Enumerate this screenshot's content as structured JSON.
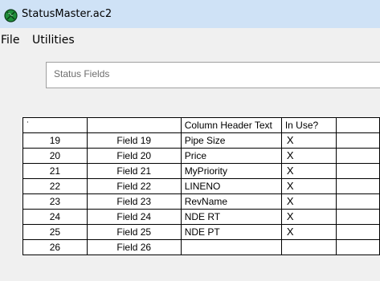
{
  "window": {
    "title": "StatusMaster.ac2"
  },
  "menu": {
    "items": [
      "File",
      "Utilities"
    ]
  },
  "status_box": {
    "label": "Status Fields"
  },
  "grid": {
    "header": {
      "corner": "˙",
      "field": "",
      "column_header_text": "Column Header Text",
      "in_use": "In Use?"
    },
    "rows": [
      {
        "num": "19",
        "field": "Field 19",
        "header_text": "Pipe Size",
        "in_use": "X"
      },
      {
        "num": "20",
        "field": "Field 20",
        "header_text": "Price",
        "in_use": "X"
      },
      {
        "num": "21",
        "field": "Field 21",
        "header_text": "MyPriority",
        "in_use": "X"
      },
      {
        "num": "22",
        "field": "Field 22",
        "header_text": "LINENO",
        "in_use": "X"
      },
      {
        "num": "23",
        "field": "Field 23",
        "header_text": "RevName",
        "in_use": "X"
      },
      {
        "num": "24",
        "field": "Field 24",
        "header_text": "NDE RT",
        "in_use": "X"
      },
      {
        "num": "25",
        "field": "Field 25",
        "header_text": "NDE PT",
        "in_use": "X"
      },
      {
        "num": "26",
        "field": "Field 26",
        "header_text": "",
        "in_use": ""
      }
    ]
  }
}
